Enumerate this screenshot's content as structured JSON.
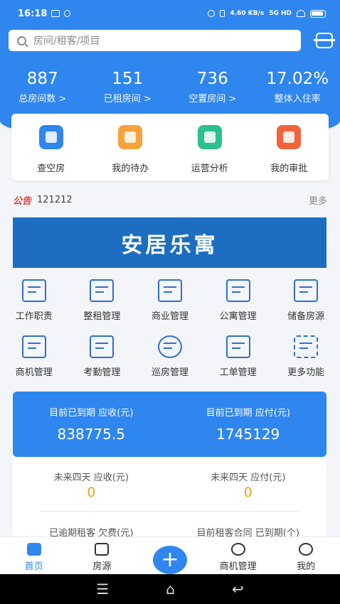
{
  "status": {
    "time": "16:18",
    "net": "4.60 KB/s",
    "signal": "5G HD"
  },
  "search": {
    "placeholder": "房间/租客/项目"
  },
  "stats": [
    {
      "num": "887",
      "label": "总房间数 >"
    },
    {
      "num": "151",
      "label": "已租房间 >"
    },
    {
      "num": "736",
      "label": "空置房间 >"
    },
    {
      "num": "17.02%",
      "label": "整体入住率"
    }
  ],
  "quick": [
    {
      "label": "查空房",
      "color": "#2f86ef",
      "icon": "search-house-icon"
    },
    {
      "label": "我的待办",
      "color": "#f7a23b",
      "icon": "calendar-clock-icon"
    },
    {
      "label": "运营分析",
      "color": "#2bc18a",
      "icon": "chart-icon"
    },
    {
      "label": "我的审批",
      "color": "#f0643c",
      "icon": "stamp-icon"
    }
  ],
  "notice": {
    "tag": "公告",
    "text": "121212",
    "more": "更多"
  },
  "banner": {
    "text": "安居乐寓"
  },
  "grid": [
    [
      {
        "label": "工作职责"
      },
      {
        "label": "整租管理"
      },
      {
        "label": "商业管理"
      },
      {
        "label": "公寓管理"
      },
      {
        "label": "储备房源"
      }
    ],
    [
      {
        "label": "商机管理"
      },
      {
        "label": "考勤管理"
      },
      {
        "label": "巡房管理"
      },
      {
        "label": "工单管理"
      },
      {
        "label": "更多功能"
      }
    ]
  ],
  "money": [
    {
      "title": "目前已到期 应收(元)",
      "value": "838775.5"
    },
    {
      "title": "目前已到期 应付(元)",
      "value": "1745129"
    }
  ],
  "future": [
    {
      "title": "未来四天 应收(元)",
      "value": "0"
    },
    {
      "title": "未来四天 应付(元)",
      "value": "0"
    }
  ],
  "future2": [
    {
      "title": "已逾期租客 欠费(元)"
    },
    {
      "title": "目前租客合同 已到期(个)"
    }
  ],
  "tabs": [
    {
      "label": "首页"
    },
    {
      "label": "房源"
    },
    {
      "label": "+"
    },
    {
      "label": "商机管理"
    },
    {
      "label": "我的"
    }
  ]
}
